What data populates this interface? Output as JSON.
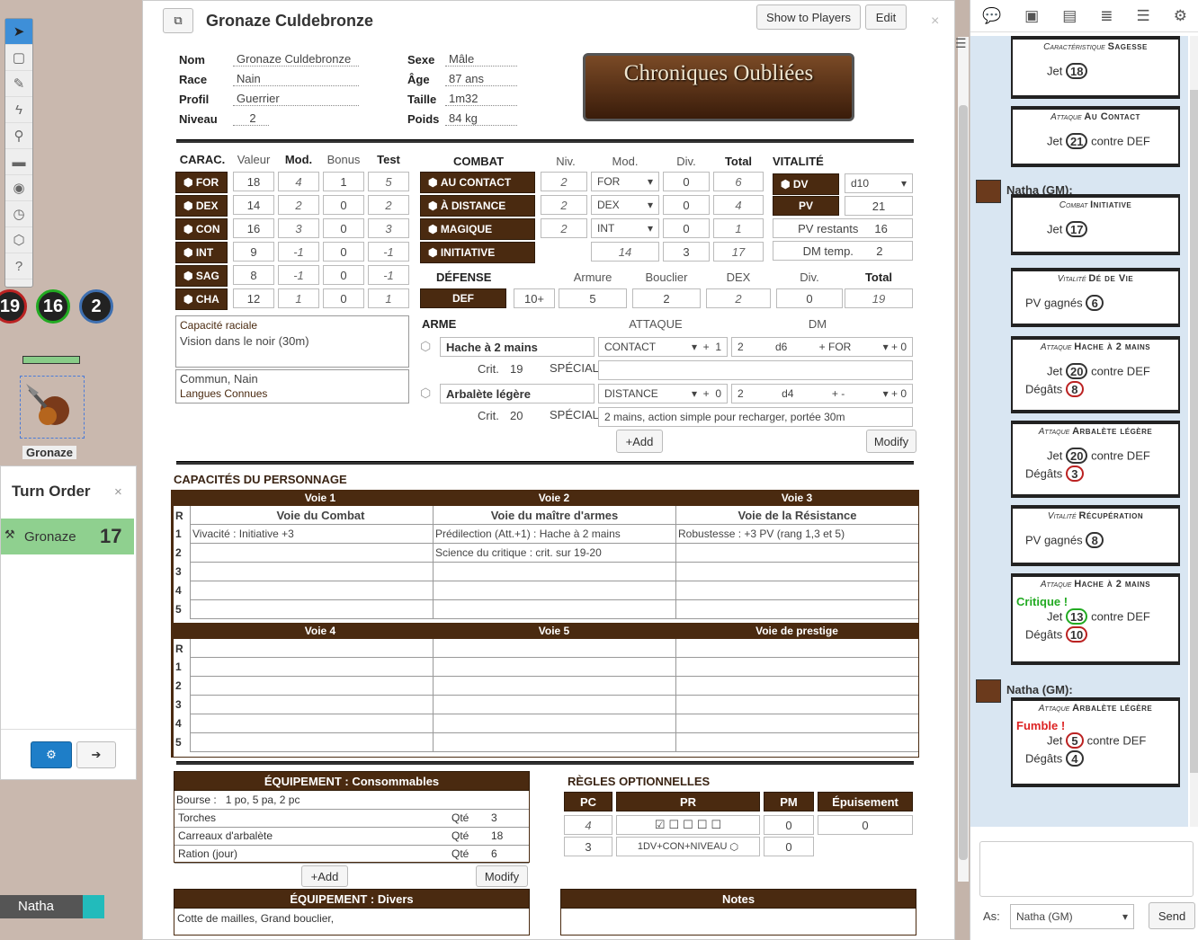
{
  "vtt": {
    "tokens": [
      "19",
      "16",
      "2"
    ],
    "token_name": "Gronaze",
    "turn_order_title": "Turn Order",
    "turn_order_entry": "Gronaze",
    "turn_order_value": "17",
    "player_name": "Natha"
  },
  "sheet": {
    "title": "Gronaze Culdebronze",
    "show_players": "Show to Players",
    "edit": "Edit",
    "identity": {
      "nom_l": "Nom",
      "nom": "Gronaze Culdebronze",
      "race_l": "Race",
      "race": "Nain",
      "profil_l": "Profil",
      "profil": "Guerrier",
      "niveau_l": "Niveau",
      "niveau": "2",
      "sexe_l": "Sexe",
      "sexe": "Mâle",
      "age_l": "Âge",
      "age": "87 ans",
      "taille_l": "Taille",
      "taille": "1m32",
      "poids_l": "Poids",
      "poids": "84 kg"
    },
    "logo": "Chroniques Oubliées",
    "carac": {
      "head": [
        "CARAC.",
        "Valeur",
        "Mod.",
        "Bonus",
        "Test"
      ],
      "rows": [
        [
          "FOR",
          "18",
          "4",
          "1",
          "5"
        ],
        [
          "DEX",
          "14",
          "2",
          "0",
          "2"
        ],
        [
          "CON",
          "16",
          "3",
          "0",
          "3"
        ],
        [
          "INT",
          "9",
          "-1",
          "0",
          "-1"
        ],
        [
          "SAG",
          "8",
          "-1",
          "0",
          "-1"
        ],
        [
          "CHA",
          "12",
          "1",
          "0",
          "1"
        ]
      ]
    },
    "combat": {
      "head": [
        "COMBAT",
        "Niv.",
        "Mod.",
        "Div.",
        "Total"
      ],
      "rows": [
        [
          "AU CONTACT",
          "2",
          "FOR",
          "0",
          "6"
        ],
        [
          "À DISTANCE",
          "2",
          "DEX",
          "0",
          "4"
        ],
        [
          "MAGIQUE",
          "2",
          "INT",
          "0",
          "1"
        ]
      ],
      "init": [
        "INITIATIVE",
        "14",
        "3",
        "17"
      ]
    },
    "vitalite": {
      "head": "VITALITÉ",
      "dv_l": "DV",
      "dv": "d10",
      "pv_l": "PV",
      "pv": "21",
      "pvr_l": "PV restants",
      "pvr": "16",
      "dmt_l": "DM temp.",
      "dmt": "2"
    },
    "defense": {
      "head": [
        "DÉFENSE",
        "Armure",
        "Bouclier",
        "DEX",
        "Div.",
        "Total"
      ],
      "def_l": "DEF",
      "base": "10+",
      "armure": "5",
      "bouclier": "2",
      "dex": "2",
      "div": "0",
      "total": "19"
    },
    "racial": {
      "label": "Capacité raciale",
      "value": "Vision dans le noir (30m)"
    },
    "langues": {
      "value": "Commun, Nain",
      "label": "Langues Connues"
    },
    "armes": {
      "head": [
        "ARME",
        "ATTAQUE",
        "DM"
      ],
      "rows": [
        {
          "name": "Hache à 2 mains",
          "atk": "CONTACT",
          "atkb": "1",
          "dmn": "2",
          "dmd": "d6",
          "dmm": "+ FOR",
          "dmb": "0",
          "crit_l": "Crit.",
          "crit": "19",
          "sp_l": "SPÉCIAL",
          "sp": ""
        },
        {
          "name": "Arbalète légère",
          "atk": "DISTANCE",
          "atkb": "0",
          "dmn": "2",
          "dmd": "d4",
          "dmm": "+ -",
          "dmb": "0",
          "crit_l": "Crit.",
          "crit": "20",
          "sp_l": "SPÉCIAL",
          "sp": "2 mains, action simple pour recharger, portée 30m"
        }
      ],
      "add": "+Add",
      "modify": "Modify"
    },
    "caps": {
      "title": "CAPACITÉS DU PERSONNAGE",
      "voies1": [
        "Voie 1",
        "Voie 2",
        "Voie 3"
      ],
      "noms1": [
        "Voie du Combat",
        "Voie du maître d'armes",
        "Voie de la Résistance"
      ],
      "rows1": [
        [
          "Vivacité : Initiative +3",
          "Prédilection (Att.+1) : Hache à 2 mains",
          "Robustesse : +3 PV (rang 1,3 et 5)"
        ],
        [
          "",
          "Science du critique : crit. sur 19-20",
          ""
        ],
        [
          "",
          "",
          ""
        ],
        [
          "",
          "",
          ""
        ],
        [
          "",
          "",
          ""
        ]
      ],
      "voies2": [
        "Voie 4",
        "Voie 5",
        "Voie de prestige"
      ],
      "r": "R",
      "nums": [
        "1",
        "2",
        "3",
        "4",
        "5"
      ]
    },
    "equip": {
      "title": "ÉQUIPEMENT : Consommables",
      "bourse_l": "Bourse :",
      "bourse": "1 po, 5 pa, 2 pc",
      "items": [
        [
          "Torches",
          "Qté",
          "3"
        ],
        [
          "Carreaux d'arbalète",
          "Qté",
          "18"
        ],
        [
          "Ration (jour)",
          "Qté",
          "6"
        ]
      ],
      "add": "+Add",
      "modify": "Modify",
      "divers_title": "ÉQUIPEMENT : Divers",
      "divers": "Cotte de mailles, Grand bouclier,",
      "notes": "Notes"
    },
    "regles": {
      "title": "RÈGLES OPTIONNELLES",
      "head": [
        "PC",
        "PR",
        "PM",
        "Épuisement"
      ],
      "pc": "4",
      "pm": "0",
      "ep": "0",
      "pc2": "3",
      "pr_formula": "1DV+CON+NIVEAU",
      "pm2": "0"
    }
  },
  "chat": {
    "as_l": "As:",
    "as": "Natha (GM)",
    "send": "Send",
    "gm": "Natha (GM):",
    "cards": [
      {
        "t": "Caractéristique",
        "n": "Sagesse",
        "lines": [
          [
            "Jet",
            "18",
            "",
            ""
          ]
        ]
      },
      {
        "t": "Attaque",
        "n": "Au Contact",
        "lines": [
          [
            "Jet",
            "21",
            "",
            "contre DEF"
          ]
        ]
      },
      {
        "t": "Combat",
        "n": "Initiative",
        "lines": [
          [
            "Jet",
            "17",
            "",
            ""
          ]
        ]
      },
      {
        "t": "Vitalité",
        "n": "Dé de Vie",
        "lines": [
          [
            "PV gagnés",
            "6",
            "",
            ""
          ]
        ]
      },
      {
        "t": "Attaque",
        "n": "Hache à 2 mains",
        "lines": [
          [
            "Jet",
            "20",
            "",
            "contre DEF"
          ],
          [
            "Dégâts",
            "8",
            "red",
            ""
          ]
        ]
      },
      {
        "t": "Attaque",
        "n": "Arbalète légère",
        "lines": [
          [
            "Jet",
            "20",
            "",
            "contre DEF"
          ],
          [
            "Dégâts",
            "3",
            "red",
            ""
          ]
        ]
      },
      {
        "t": "Vitalité",
        "n": "Récupération",
        "lines": [
          [
            "PV gagnés",
            "8",
            "",
            ""
          ]
        ]
      },
      {
        "t": "Attaque",
        "n": "Hache à 2 mains",
        "special": "Critique !",
        "lines": [
          [
            "Jet",
            "13",
            "green",
            "contre DEF"
          ],
          [
            "Dégâts",
            "10",
            "red",
            ""
          ]
        ]
      },
      {
        "t": "Attaque",
        "n": "Arbalète légère",
        "special2": "Fumble !",
        "lines": [
          [
            "Jet",
            "5",
            "red",
            "contre DEF"
          ],
          [
            "Dégâts",
            "4",
            "",
            ""
          ]
        ]
      }
    ]
  }
}
